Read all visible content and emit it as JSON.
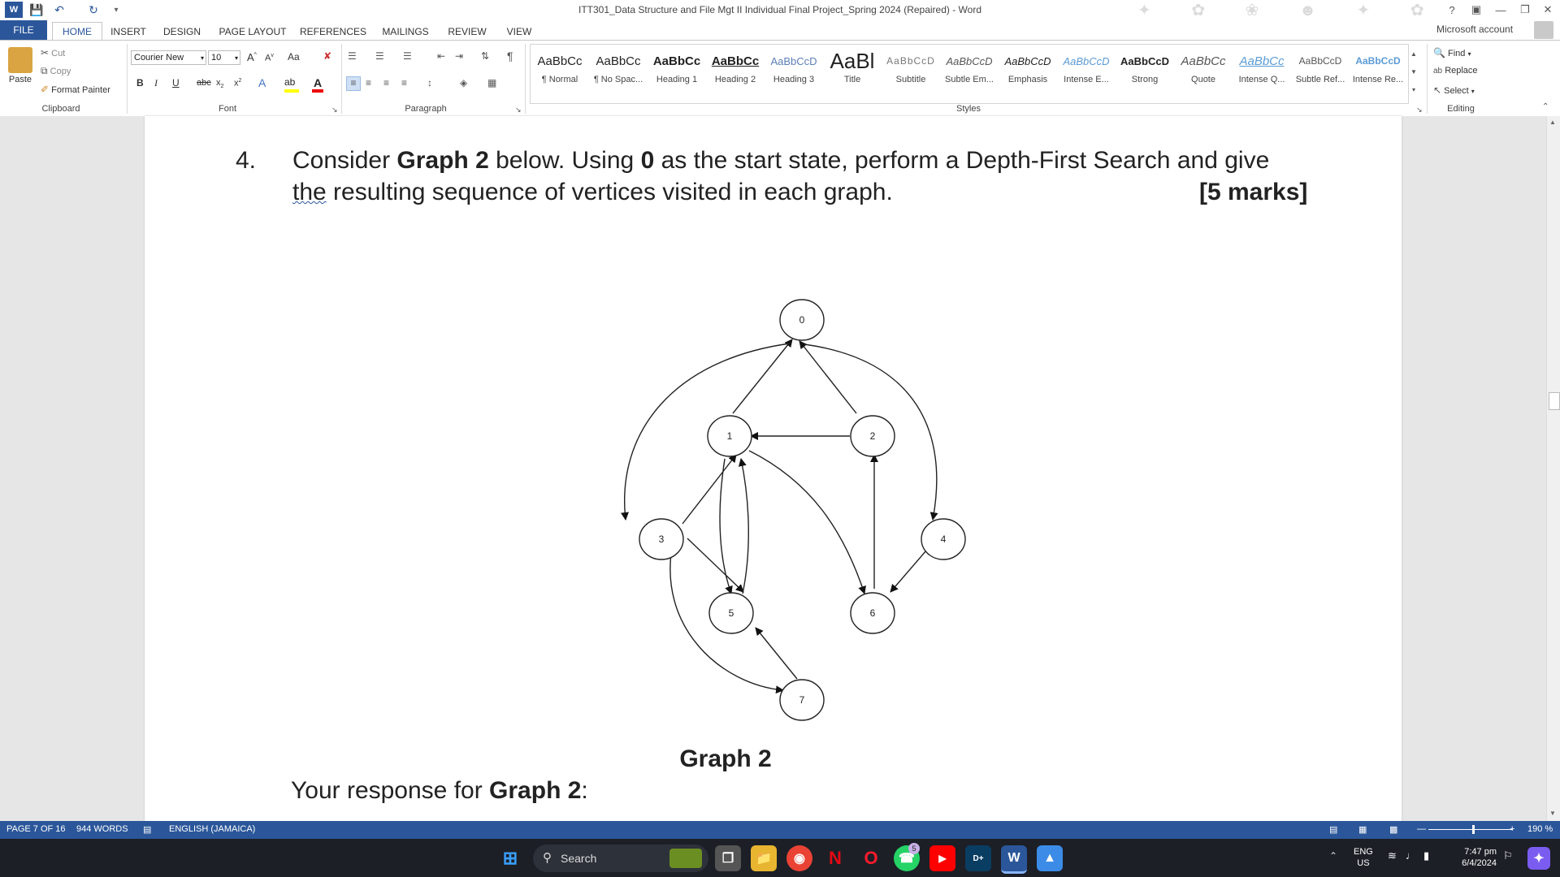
{
  "window": {
    "title": "ITT301_Data Structure and File Mgt II Individual Final Project_Spring 2024 (Repaired) - Word",
    "help": "?",
    "account": "Microsoft account"
  },
  "tabs": [
    "FILE",
    "HOME",
    "INSERT",
    "DESIGN",
    "PAGE LAYOUT",
    "REFERENCES",
    "MAILINGS",
    "REVIEW",
    "VIEW"
  ],
  "clipboard": {
    "paste": "Paste",
    "cut": "Cut",
    "copy": "Copy",
    "format_painter": "Format Painter",
    "label": "Clipboard"
  },
  "font": {
    "name": "Courier New",
    "size": "10",
    "label": "Font",
    "case": "Aa"
  },
  "paragraph": {
    "label": "Paragraph"
  },
  "styles": {
    "label": "Styles",
    "items": [
      {
        "preview": "AaBbCc",
        "name": "¶ Normal"
      },
      {
        "preview": "AaBbCc",
        "name": "¶ No Spac..."
      },
      {
        "preview": "AaBbCc",
        "name": "Heading 1"
      },
      {
        "preview": "AaBbCc",
        "name": "Heading 2"
      },
      {
        "preview": "AaBbCcD",
        "name": "Heading 3"
      },
      {
        "preview": "AaBl",
        "name": "Title"
      },
      {
        "preview": "AaBbCcD",
        "name": "Subtitle"
      },
      {
        "preview": "AaBbCcD",
        "name": "Subtle Em..."
      },
      {
        "preview": "AaBbCcD",
        "name": "Emphasis"
      },
      {
        "preview": "AaBbCcD",
        "name": "Intense E..."
      },
      {
        "preview": "AaBbCcD",
        "name": "Strong"
      },
      {
        "preview": "AaBbCc",
        "name": "Quote"
      },
      {
        "preview": "AaBbCc",
        "name": "Intense Q..."
      },
      {
        "preview": "AaBbCcD",
        "name": "Subtle Ref..."
      },
      {
        "preview": "AaBbCcD",
        "name": "Intense Re..."
      }
    ]
  },
  "editing": {
    "label": "Editing",
    "find": "Find",
    "replace": "Replace",
    "select": "Select"
  },
  "document": {
    "q_number": "4.",
    "q_line1_a": "Consider ",
    "q_line1_b": "Graph 2",
    "q_line1_c": " below. Using ",
    "q_line1_d": "0",
    "q_line1_e": " as the start state, perform a Depth-First Search and give",
    "q_line2_a": "the",
    "q_line2_b": " resulting sequence of vertices visited in each graph.",
    "marks": "[5 marks]",
    "graph_caption": "Graph 2",
    "response_a": "Your response for ",
    "response_b": "Graph 2",
    "response_c": ":",
    "graph_nodes": [
      "0",
      "1",
      "2",
      "3",
      "4",
      "5",
      "6",
      "7"
    ]
  },
  "status": {
    "page": "PAGE 7 OF 16",
    "words": "944 WORDS",
    "language": "ENGLISH (JAMAICA)",
    "zoom": "190 %"
  },
  "taskbar": {
    "search": "Search",
    "lang1": "ENG",
    "lang2": "US",
    "time": "7:47 pm",
    "date": "6/4/2024",
    "badge": "5"
  }
}
